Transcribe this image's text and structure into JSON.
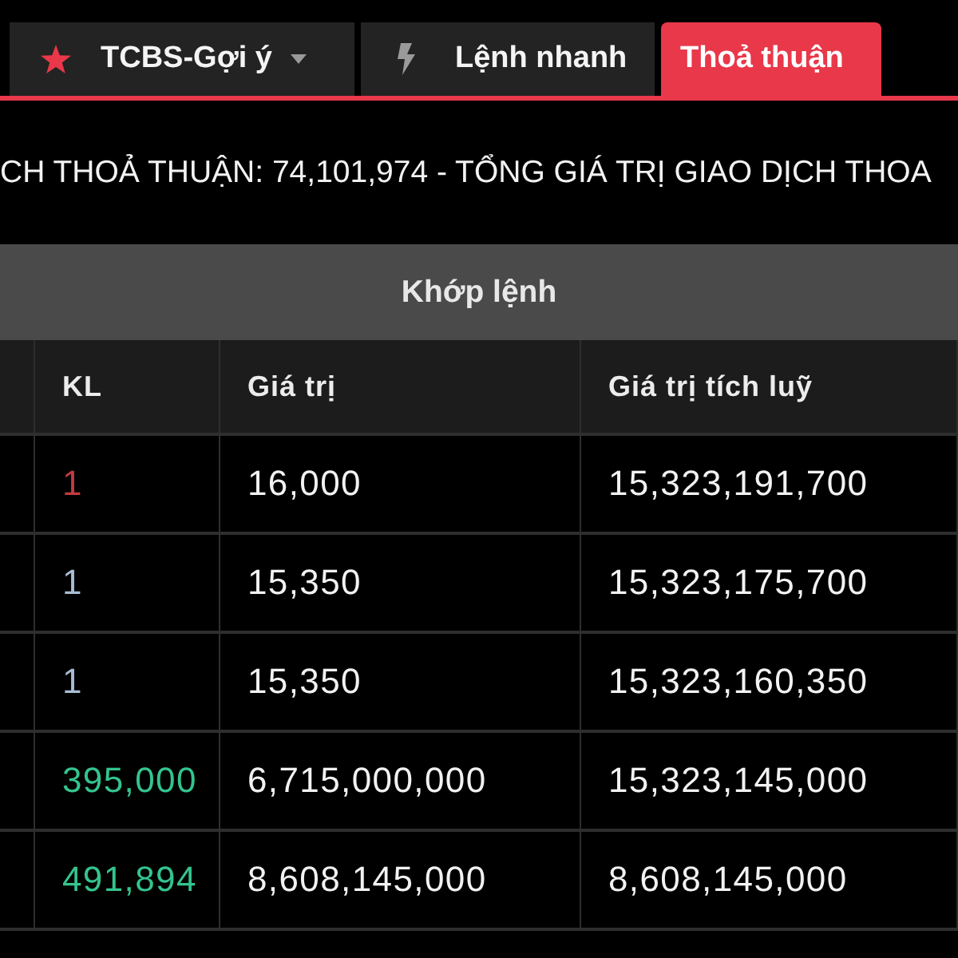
{
  "tabs": [
    {
      "label": "TCBS-Gợi ý",
      "kind": "dropdown",
      "selected": false
    },
    {
      "label": "Lệnh nhanh",
      "kind": "plain",
      "selected": false
    },
    {
      "label": "Thoả thuận",
      "kind": "plain",
      "selected": true
    }
  ],
  "ticker": {
    "text": "CH THOẢ THUẬN: 74,101,974 - TỔNG GIÁ TRỊ GIAO DỊCH THOA"
  },
  "table": {
    "group_header": "Khớp lệnh",
    "columns": [
      "KL",
      "Giá trị",
      "Giá trị tích luỹ"
    ],
    "rows": [
      {
        "kl": "1",
        "color": "#c23a40",
        "value": "16,000",
        "cumulative": "15,323,191,700"
      },
      {
        "kl": "1",
        "color": "#a8bcd4",
        "value": "15,350",
        "cumulative": "15,323,175,700"
      },
      {
        "kl": "1",
        "color": "#a8bcd4",
        "value": "15,350",
        "cumulative": "15,323,160,350"
      },
      {
        "kl": "395,000",
        "color": "#34c48e",
        "value": "6,715,000,000",
        "cumulative": "15,323,145,000"
      },
      {
        "kl": "491,894",
        "color": "#34c48e",
        "value": "8,608,145,000",
        "cumulative": "8,608,145,000"
      }
    ]
  }
}
